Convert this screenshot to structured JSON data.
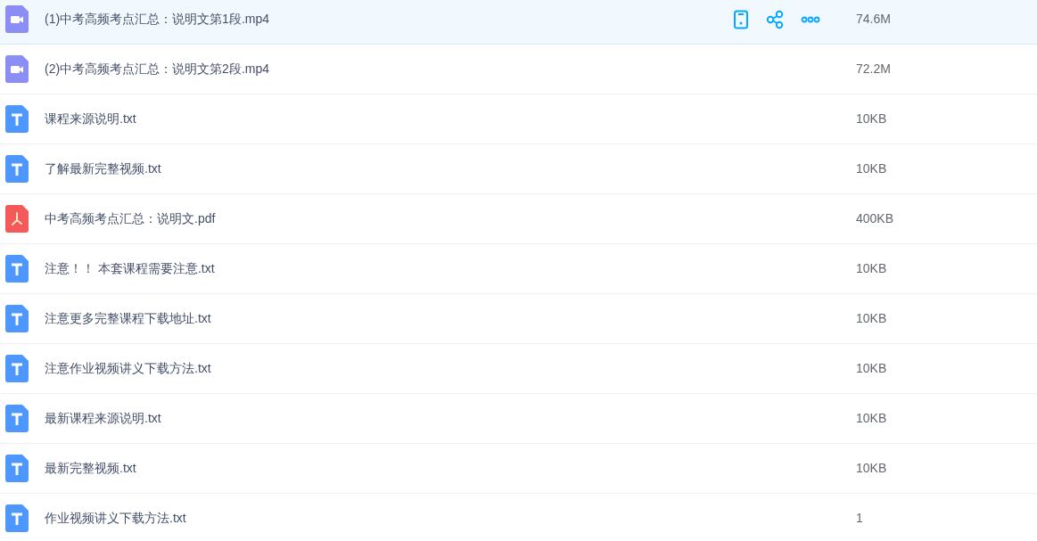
{
  "files": [
    {
      "kind": "video",
      "name": "(1)中考高频考点汇总：说明文第1段.mp4",
      "size": "74.6M",
      "selected": true
    },
    {
      "kind": "video",
      "name": "(2)中考高频考点汇总：说明文第2段.mp4",
      "size": "72.2M",
      "selected": false
    },
    {
      "kind": "text",
      "name": "课程来源说明.txt",
      "size": "10KB",
      "selected": false
    },
    {
      "kind": "text",
      "name": "了解最新完整视频.txt",
      "size": "10KB",
      "selected": false
    },
    {
      "kind": "pdf",
      "name": "中考高频考点汇总：说明文.pdf",
      "size": "400KB",
      "selected": false
    },
    {
      "kind": "text",
      "name": "注意！！ 本套课程需要注意.txt",
      "size": "10KB",
      "selected": false
    },
    {
      "kind": "text",
      "name": "注意更多完整课程下载地址.txt",
      "size": "10KB",
      "selected": false
    },
    {
      "kind": "text",
      "name": "注意作业视频讲义下载方法.txt",
      "size": "10KB",
      "selected": false
    },
    {
      "kind": "text",
      "name": "最新课程来源说明.txt",
      "size": "10KB",
      "selected": false
    },
    {
      "kind": "text",
      "name": "最新完整视频.txt",
      "size": "10KB",
      "selected": false
    },
    {
      "kind": "text",
      "name": "作业视频讲义下载方法.txt",
      "size": "1",
      "selected": false
    }
  ]
}
